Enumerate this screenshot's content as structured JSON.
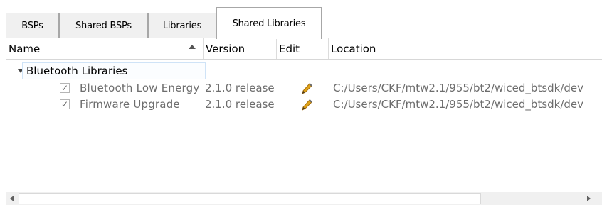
{
  "tabs": [
    {
      "label": "BSPs",
      "active": false
    },
    {
      "label": "Shared BSPs",
      "active": false
    },
    {
      "label": "Libraries",
      "active": false
    },
    {
      "label": "Shared Libraries",
      "active": true
    }
  ],
  "table": {
    "columns": [
      "Name",
      "Version",
      "Edit",
      "Location"
    ],
    "sort": {
      "column": "Name",
      "direction": "ascending"
    },
    "group": {
      "label": "Bluetooth Libraries",
      "expanded": true,
      "items": [
        {
          "name": "Bluetooth Low Energy",
          "checked": true,
          "version": "2.1.0 release",
          "edit_icon": "pencil-icon",
          "location": "C:/Users/CKF/mtw2.1/955/bt2/wiced_btsdk/dev"
        },
        {
          "name": "Firmware Upgrade",
          "checked": true,
          "version": "2.1.0 release",
          "edit_icon": "pencil-icon",
          "location": "C:/Users/CKF/mtw2.1/955/bt2/wiced_btsdk/dev"
        }
      ]
    }
  },
  "checkmark_glyph": "✓",
  "colors": {
    "selection_border": "#cfe3f7",
    "disabled_text": "#6d6d6d",
    "pencil": "#e0a41a"
  }
}
